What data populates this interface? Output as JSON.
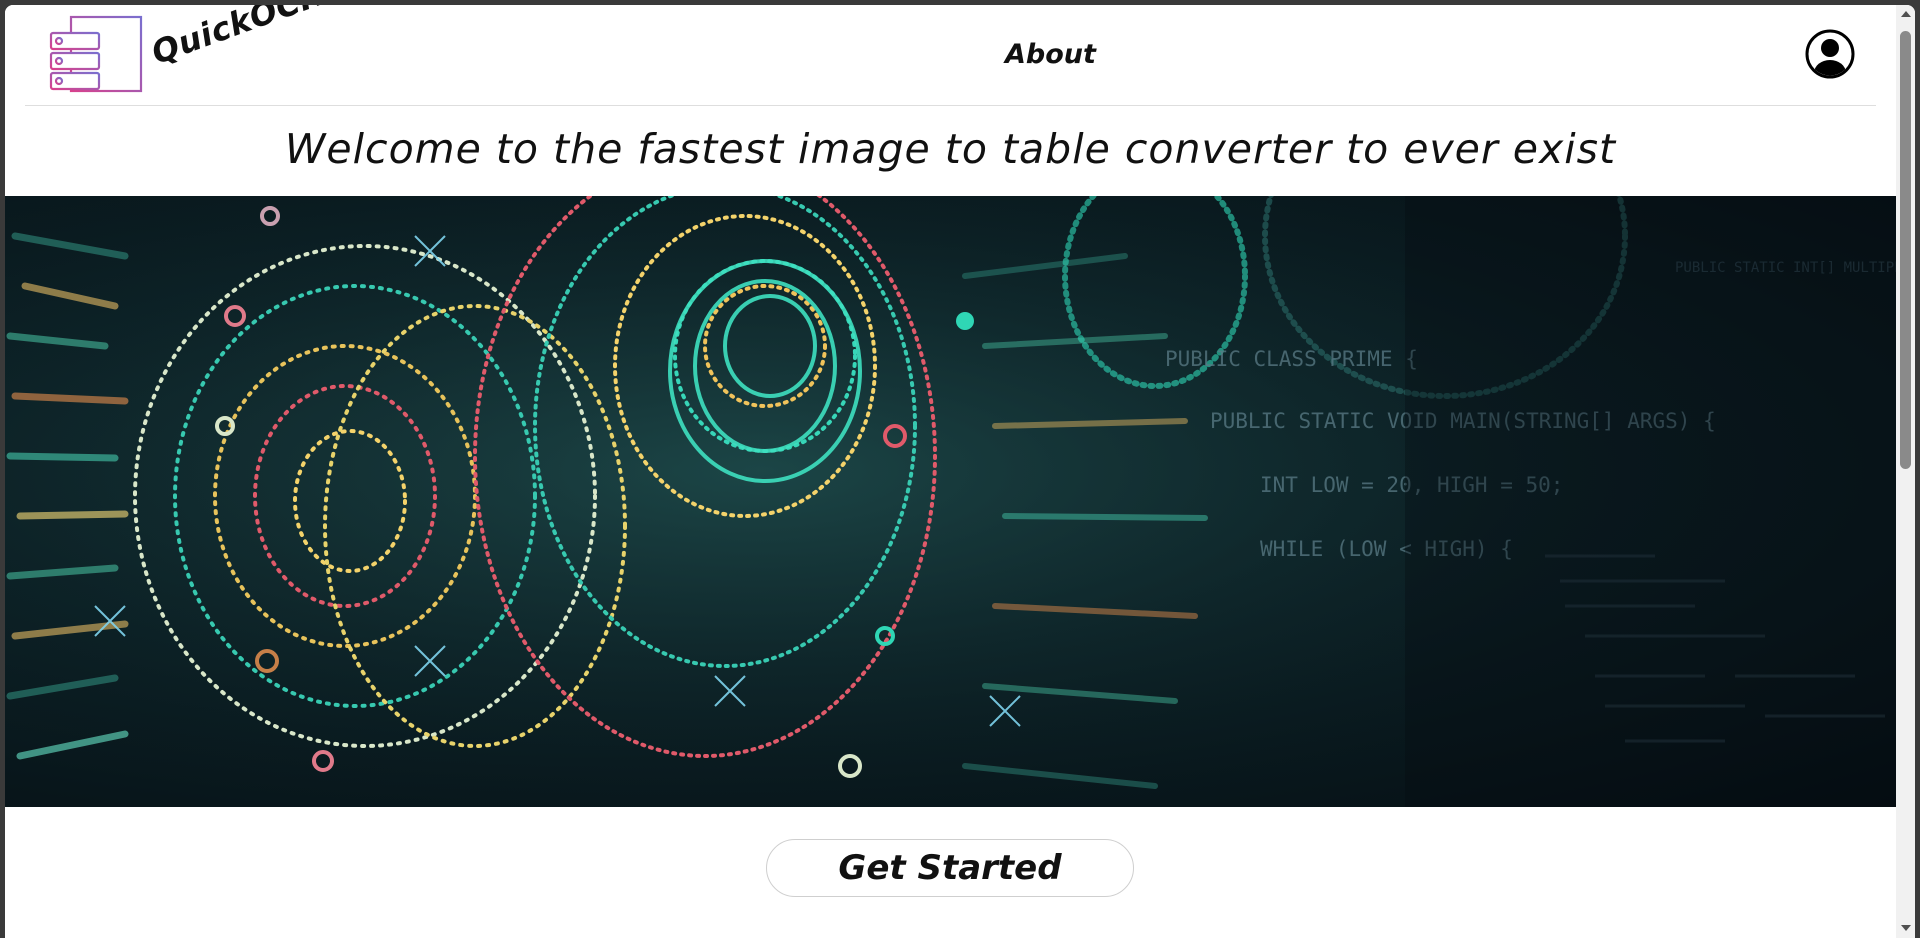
{
  "app": {
    "name": "QuickOCR"
  },
  "nav": {
    "about_label": "About"
  },
  "hero": {
    "headline": "Welcome to the fastest image to table converter to ever exist",
    "code_lines": [
      "PUBLIC CLASS PRIME {",
      "PUBLIC STATIC VOID MAIN(STRING[] ARGS) {",
      "INT LOW = 20, HIGH = 50;",
      "WHILE (LOW < HIGH) {",
      "PUBLIC STATIC INT[] MULTIPLY"
    ]
  },
  "cta": {
    "label": "Get Started"
  },
  "icons": {
    "logo": "table-list-logo-icon",
    "profile": "user-circle-icon"
  },
  "colors": {
    "logo_gradient_start": "#d8418c",
    "logo_gradient_end": "#7a6fcf",
    "hero_teal": "#2fd6b5",
    "hero_dark": "#08161b"
  }
}
